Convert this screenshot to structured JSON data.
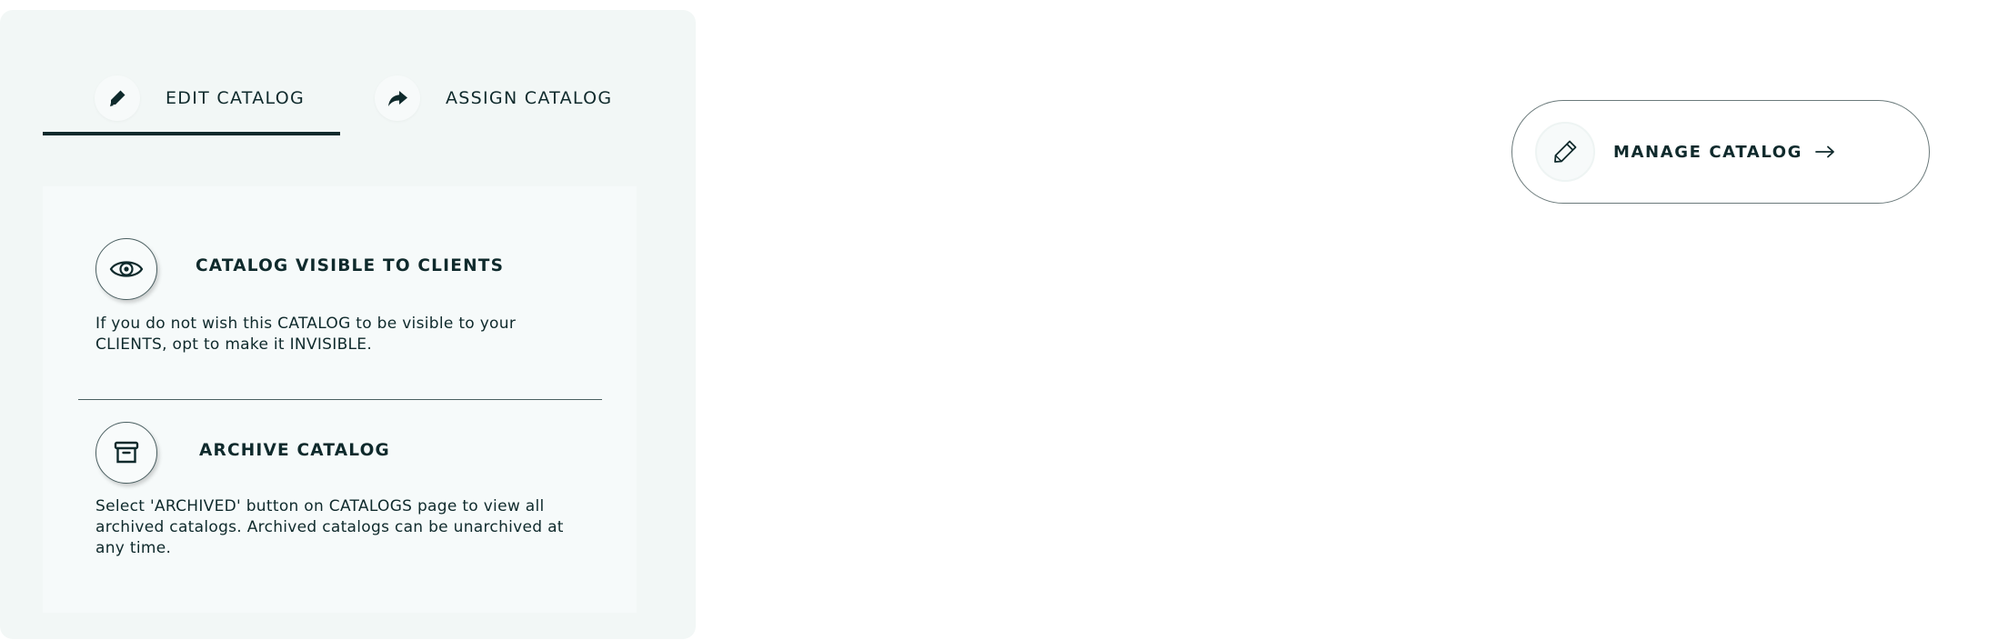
{
  "tabs": {
    "edit": {
      "label": "EDIT CATALOG",
      "icon": "pen-icon",
      "active": true
    },
    "assign": {
      "label": "ASSIGN CATALOG",
      "icon": "share-arrow-icon",
      "active": false
    }
  },
  "sections": {
    "visibility": {
      "title": "CATALOG VISIBLE TO CLIENTS",
      "text": "If you do not wish this CATALOG to be visible to your CLIENTS, opt to make it INVISIBLE.",
      "icon": "eye-icon"
    },
    "archive": {
      "title": "ARCHIVE CATALOG",
      "text": "Select 'ARCHIVED' button on CATALOGS page to view all archived catalogs. Archived catalogs can be unarchived at any time.",
      "icon": "archive-box-icon"
    }
  },
  "manage": {
    "label": "MANAGE CATALOG",
    "icon": "pencil-icon",
    "arrow": "arrow-right-icon"
  },
  "colors": {
    "text": "#0f2a2c",
    "panel_bg": "#f2f7f6",
    "card_bg": "#f6fafa"
  }
}
